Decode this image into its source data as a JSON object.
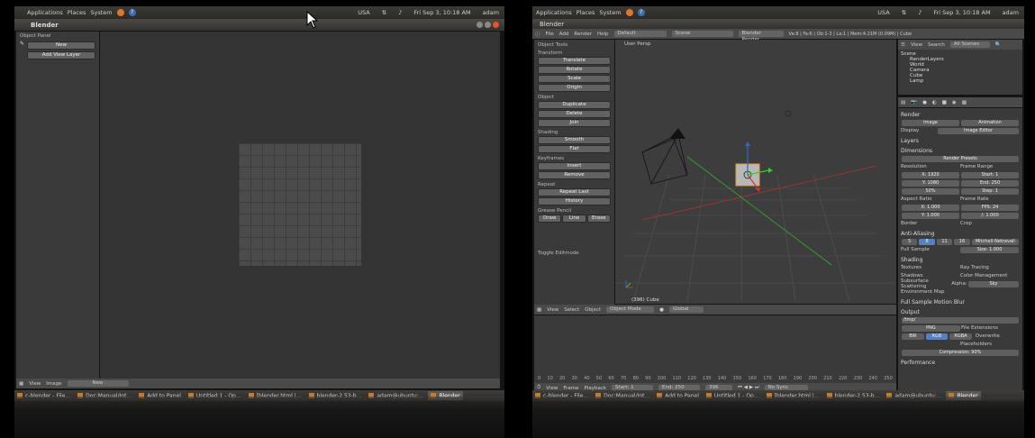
{
  "left": {
    "topbar": {
      "menus": [
        "Applications",
        "Places",
        "System"
      ],
      "keyboard": "USA",
      "datetime": "Fri Sep 3, 10:18 AM",
      "user": "adam"
    },
    "window_title": "Blender",
    "panel": {
      "header": "Object Panel",
      "new_button": "New",
      "add_view_layer": "Add View Layer"
    },
    "bottom_header": {
      "view": "View",
      "image": "Image",
      "new": "New"
    },
    "taskbar": [
      "c-blender - File...",
      "Doc:Manual/Int...",
      "Add to Panel",
      "Untitled 1 - Op...",
      "[blender.html |...",
      "blender-2.53-b...",
      "adam@ubuntu:...",
      "Blender"
    ]
  },
  "right": {
    "topbar": {
      "menus": [
        "Applications",
        "Places",
        "System"
      ],
      "keyboard": "USA",
      "datetime": "Fri Sep 3, 10:18 AM",
      "user": "adam"
    },
    "window_title": "Blender",
    "info_header": {
      "menus": [
        "File",
        "Add",
        "Render",
        "Help"
      ],
      "layout": "Default",
      "scene": "Scene",
      "engine": "Blender Render",
      "stats": "Ve:8 | Fa:6 | Ob:1-3 | La:1 | Mem:4.21M (0.09M) | Cube"
    },
    "toolshelf": {
      "header": "Object Tools",
      "transform": "Transform",
      "translate": "Translate",
      "rotate": "Rotate",
      "scale": "Scale",
      "origin": "Origin",
      "object": "Object",
      "duplicate": "Duplicate",
      "delete": "Delete",
      "join": "Join",
      "shading": "Shading",
      "smooth": "Smooth",
      "flat": "Flat",
      "keyframes": "Keyframes",
      "insert": "Insert",
      "remove": "Remove",
      "repeat": "Repeat",
      "repeat_last": "Repeat Last",
      "history": "History",
      "grease_pencil": "Grease Pencil",
      "draw": "Draw",
      "line": "Line",
      "erase": "Erase",
      "toggle_editmode": "Toggle Editmode"
    },
    "viewport": {
      "label": "User Persp",
      "object_label": "(396) Cube"
    },
    "viewport_header": {
      "view": "View",
      "select": "Select",
      "object": "Object",
      "mode": "Object Mode",
      "pivot": "Global"
    },
    "outliner": {
      "view": "View",
      "search": "Search",
      "all_scenes": "All Scenes",
      "items": [
        "Scene",
        "RenderLayers",
        "World",
        "Camera",
        "Cube",
        "Lamp"
      ]
    },
    "properties": {
      "render": "Render",
      "image": "Image",
      "animation": "Animation",
      "display": "Display",
      "display_value": "Image Editor",
      "layers": "Layers",
      "dimensions": "Dimensions",
      "presets": "Render Presets",
      "resolution": "Resolution",
      "res_x": "X: 1920",
      "res_y": "Y: 1080",
      "res_pct": "50%",
      "frame_range": "Frame Range",
      "start": "Start: 1",
      "end": "End: 250",
      "step": "Step: 1",
      "aspect_ratio": "Aspect Ratio",
      "asp_x": "X: 1.000",
      "asp_y": "Y: 1.000",
      "frame_rate": "Frame Rate",
      "fps": "FPS: 24",
      "fps_base": "/: 1.000",
      "border": "Border",
      "crop": "Crop",
      "antialiasing": "Anti-Aliasing",
      "aa_samples": [
        "5",
        "8",
        "11",
        "16"
      ],
      "aa_filter": "Mitchell-Netravali",
      "full_sample": "Full Sample",
      "size": "Size: 1.000",
      "shading": "Shading",
      "textures": "Textures",
      "shadows": "Shadows",
      "sss": "Subsurface Scattering",
      "env_map": "Environment Map",
      "ray_tracing": "Ray Tracing",
      "color_mgmt": "Color Management",
      "alpha": "Alpha:",
      "alpha_value": "Sky",
      "motion_blur": "Full Sample Motion Blur",
      "output": "Output",
      "path": "/tmp/",
      "format": "PNG",
      "bw": "BW",
      "rgb": "RGB",
      "rgba": "RGBA",
      "file_ext": "File Extensions",
      "overwrite": "Overwrite",
      "placeholders": "Placeholders",
      "compression": "Compression: 90%",
      "performance": "Performance"
    },
    "timeline_header": {
      "view": "View",
      "frame": "Frame",
      "playback": "Playback",
      "start": "Start: 1",
      "end": "End: 250",
      "current": "396",
      "sync": "No Sync"
    },
    "timeline_ruler": [
      "0",
      "10",
      "20",
      "30",
      "40",
      "50",
      "60",
      "70",
      "80",
      "90",
      "100",
      "110",
      "120",
      "130",
      "140",
      "150",
      "160",
      "170",
      "180",
      "190",
      "200",
      "210",
      "220",
      "230",
      "240",
      "250"
    ],
    "taskbar": [
      "c-blender - File...",
      "Doc:Manual/Int...",
      "Add to Panel",
      "Untitled 1 - Op...",
      "[blender.html |...",
      "blender-2.53-b...",
      "adam@ubuntu:...",
      "Blender"
    ]
  },
  "colors": {
    "accent": "#e0562a",
    "selected": "#5680c2",
    "axis_x": "#c33",
    "axis_y": "#3c3",
    "axis_z": "#36c"
  }
}
